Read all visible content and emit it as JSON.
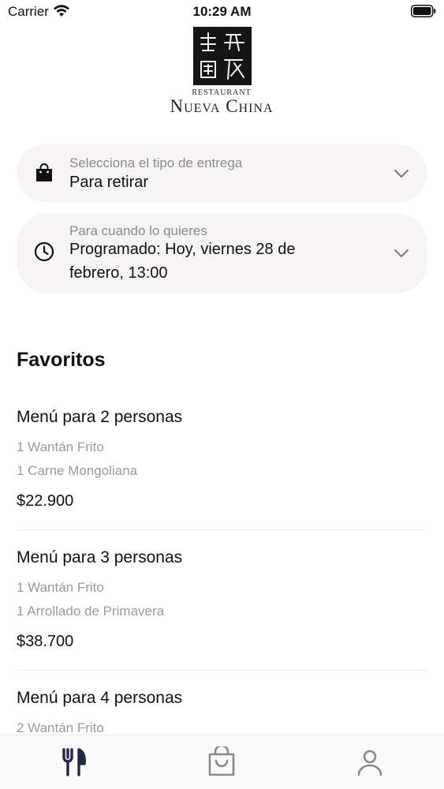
{
  "status_bar": {
    "carrier": "Carrier",
    "time": "10:29 AM"
  },
  "logo": {
    "restaurant_label": "Restaurant",
    "name": "Nueva China"
  },
  "delivery": {
    "caption": "Selecciona el tipo de entrega",
    "value": "Para retirar",
    "icon": "shopping-bag-icon"
  },
  "schedule": {
    "caption": "Para cuando lo quieres",
    "value": "Programado: Hoy, viernes 28 de febrero, 13:00",
    "icon": "clock-icon"
  },
  "favorites": {
    "title": "Favoritos",
    "items": [
      {
        "title": "Menú para 2 personas",
        "lines": [
          "1 Wantán Frito",
          "1 Carne Mongoliana"
        ],
        "price": "$22.900"
      },
      {
        "title": "Menú para 3 personas",
        "lines": [
          "1 Wantán Frito",
          "1 Arrollado de Primavera"
        ],
        "price": "$38.700"
      },
      {
        "title": "Menú para 4 personas",
        "lines": [
          "2 Wantán Frito"
        ],
        "price": ""
      }
    ]
  },
  "tab_bar": {
    "tabs": [
      "fork-knife-icon",
      "shopping-bag-icon",
      "person-icon"
    ],
    "active_color": "#1f2a44",
    "inactive_color": "#8a8a8a"
  }
}
